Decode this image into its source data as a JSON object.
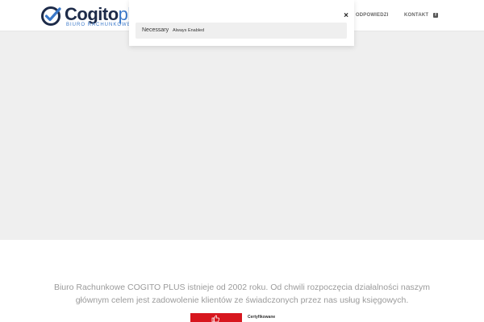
{
  "brand": {
    "name_main": "Cogito",
    "name_accent": "plus",
    "tagline": "BIURO RACHUNKOWE",
    "accent_color": "#3a78c9",
    "dark_color": "#1d2b49"
  },
  "nav": {
    "items": [
      {
        "label": "ANIA I ODPOWIEDZI"
      },
      {
        "label": "KONTAKT"
      }
    ],
    "social_icon": "facebook-icon"
  },
  "consent": {
    "close_label": "×",
    "necessary_title": "Necessary",
    "necessary_status": "Always Enabled"
  },
  "intro": {
    "text": "Biuro Rachunkowe COGITO PLUS istnieje od 2002 roku. Od chwili rozpoczęcia działalności naszym głównym celem jest zadowolenie klientów ze świadczonych przez nas usług księgowych."
  },
  "badge": {
    "label": "Certyfikowane",
    "color": "#d7161e"
  }
}
